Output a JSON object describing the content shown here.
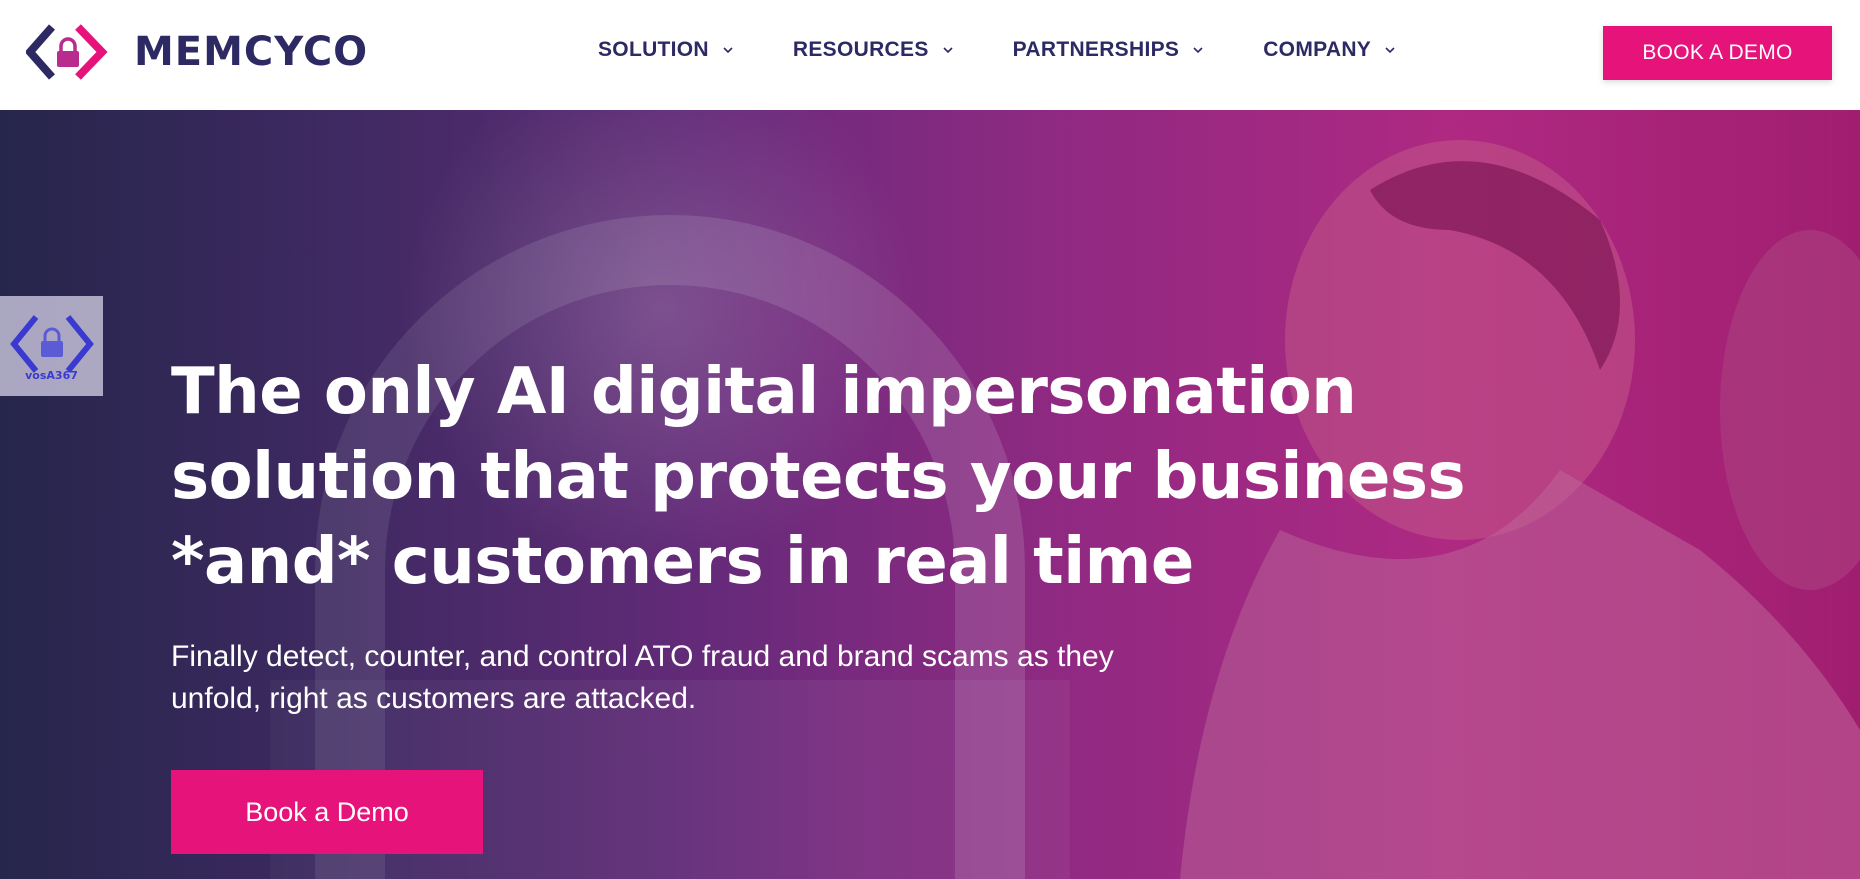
{
  "brand": {
    "name": "MEMCYCO",
    "accent_color": "#e6137a",
    "navy_color": "#2d2a63"
  },
  "nav": {
    "items": [
      {
        "label": "SOLUTION",
        "icon": "chevron-down-icon"
      },
      {
        "label": "RESOURCES",
        "icon": "chevron-down-icon"
      },
      {
        "label": "PARTNERSHIPS",
        "icon": "chevron-down-icon"
      },
      {
        "label": "COMPANY",
        "icon": "chevron-down-icon"
      }
    ],
    "cta_label": "BOOK A DEMO"
  },
  "side_badge": {
    "icon": "lock-icon",
    "label": "vosA367"
  },
  "hero": {
    "headline_lines": [
      "The only AI digital impersonation",
      "solution that protects your business",
      "*and* customers in real time"
    ],
    "subhead_lines": [
      "Finally detect, counter, and control ATO fraud and brand scams as they",
      "unfold, right as customers are attacked."
    ],
    "cta_label": "Book a Demo"
  }
}
